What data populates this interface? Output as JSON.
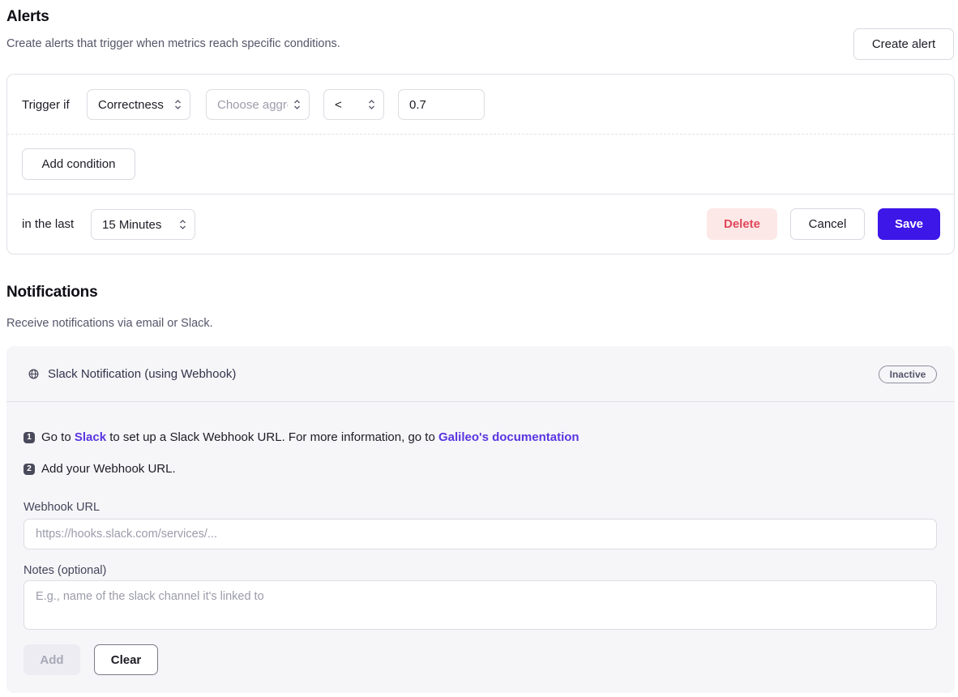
{
  "alerts": {
    "title": "Alerts",
    "subtitle": "Create alerts that trigger when metrics reach specific conditions.",
    "create_button": "Create alert",
    "trigger_label": "Trigger if",
    "metric_select": "Correctness",
    "aggregation_placeholder": "Choose aggregation",
    "operator_select": "<",
    "threshold_value": "0.7",
    "add_condition_button": "Add condition",
    "window_label": "in the last",
    "window_select": "15 Minutes",
    "delete_button": "Delete",
    "cancel_button": "Cancel",
    "save_button": "Save"
  },
  "notifications": {
    "title": "Notifications",
    "subtitle": "Receive notifications via email or Slack.",
    "slack_title": "Slack Notification (using Webhook)",
    "status_badge": "Inactive",
    "step1_num": "1",
    "step1_pre": "Go to ",
    "step1_link1": "Slack",
    "step1_mid": " to set up a Slack Webhook URL. For more information, go to ",
    "step1_link2": "Galileo's documentation",
    "step2_num": "2",
    "step2_text": "Add your Webhook URL.",
    "webhook_label": "Webhook URL",
    "webhook_placeholder": "https://hooks.slack.com/services/...",
    "notes_label": "Notes (optional)",
    "notes_placeholder": "E.g., name of the slack channel it's linked to",
    "add_button": "Add",
    "clear_button": "Clear"
  },
  "colors": {
    "primary": "#3d16e8",
    "danger_bg": "#fde8e8",
    "danger_text": "#e0485a",
    "link": "#5a35e0"
  },
  "icons": {
    "select_chevron": "chevron-up-down-icon",
    "slack": "globe-icon"
  }
}
